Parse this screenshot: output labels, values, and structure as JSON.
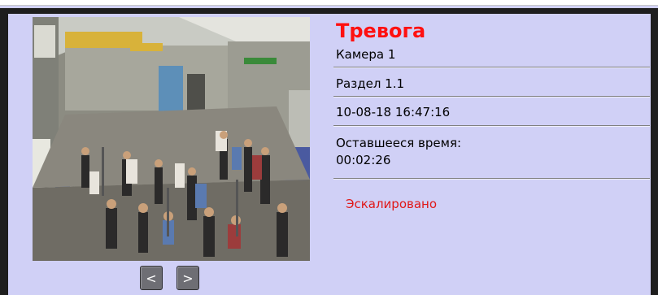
{
  "alarm": {
    "title": "Тревога",
    "camera": "Камера 1",
    "section": "Раздел 1.1",
    "timestamp": "10-08-18 16:47:16",
    "remaining_label": "Оставшееся время:",
    "remaining_value": "00:02:26",
    "status": "Эскалировано"
  },
  "navigation": {
    "prev_label": "<",
    "next_label": ">"
  },
  "colors": {
    "background": "#d0d0f6",
    "alarm_title": "#ff1010",
    "status": "#e01818",
    "frame": "#1e1e1e"
  }
}
